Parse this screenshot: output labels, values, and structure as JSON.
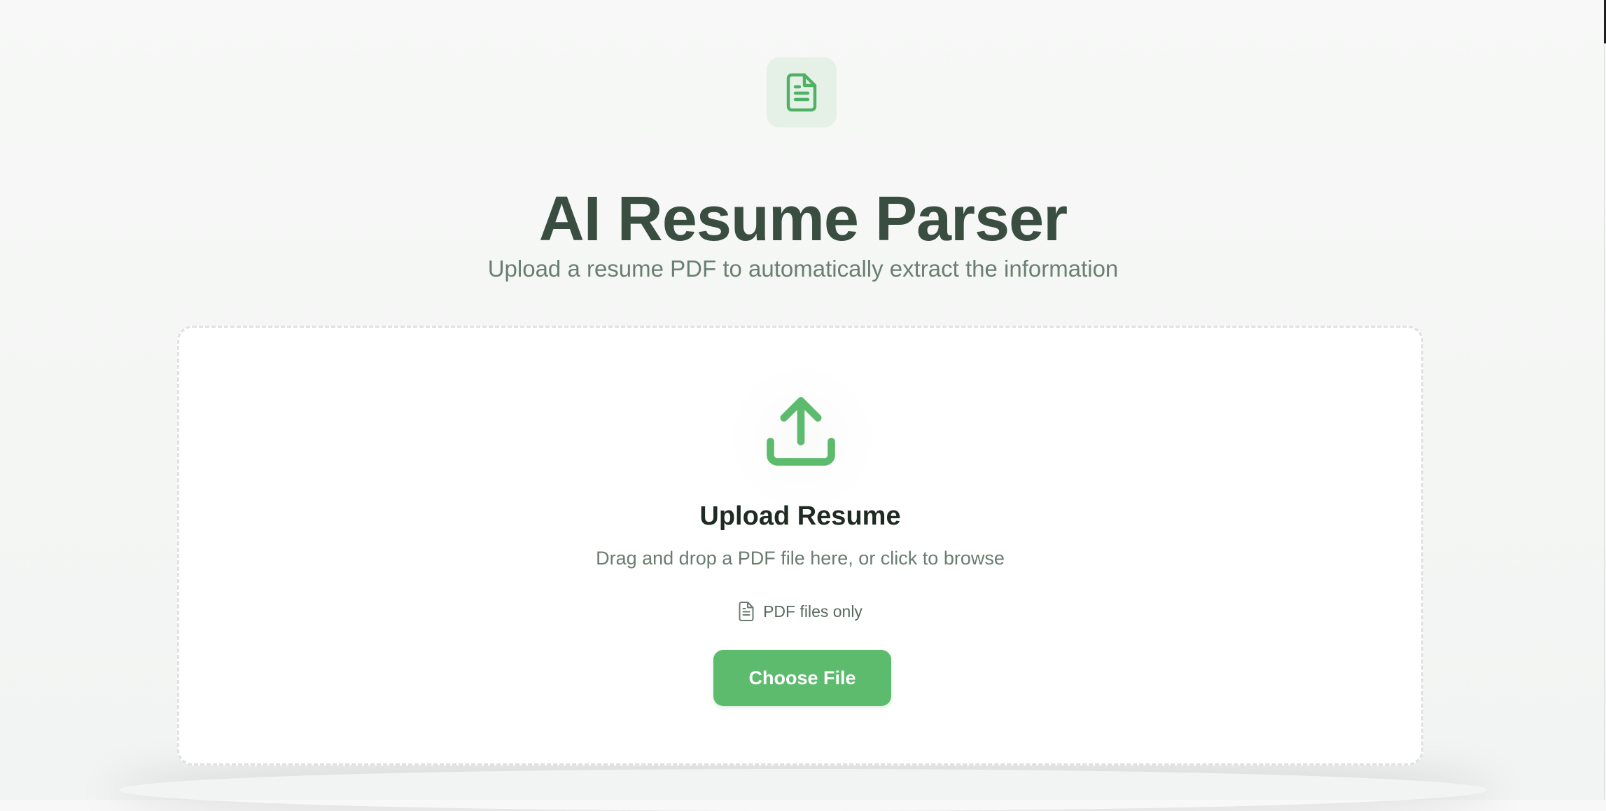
{
  "header": {
    "icon": "document-icon",
    "title": "AI Resume Parser",
    "subtitle": "Upload a resume PDF to automatically extract the information"
  },
  "upload": {
    "icon": "upload-icon",
    "title": "Upload Resume",
    "description": "Drag and drop a PDF file here, or click to browse",
    "file_note_icon": "file-icon",
    "file_note": "PDF files only",
    "button_label": "Choose File"
  },
  "colors": {
    "accent": "#5dbb6d",
    "title": "#3a4d41",
    "subtitle": "#6b7e72",
    "icon_box": "#e5f0e7"
  }
}
